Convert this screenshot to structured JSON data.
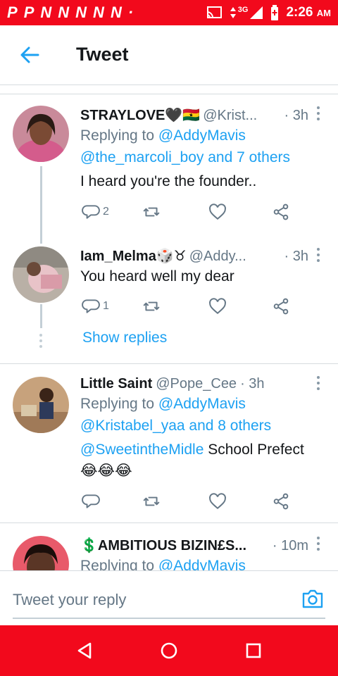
{
  "status_bar": {
    "left_icons": [
      "P",
      "P",
      "N",
      "N",
      "N",
      "N",
      "N",
      "·"
    ],
    "network": "3G",
    "time": "2:26",
    "ampm": "AM"
  },
  "header": {
    "title": "Tweet"
  },
  "tweets": [
    {
      "name": "STRAYLOVE🖤🇬🇭",
      "handle": "@Krist...",
      "time": "· 3h",
      "replying_prefix": "Replying to",
      "replying_line1": "@AddyMavis",
      "replying_line2": "@the_marcoli_boy and 7 others",
      "text": "I heard you're the founder..",
      "reply_count": "2"
    },
    {
      "name": "Iam_Melma",
      "name_emoji": "🎲♉",
      "handle": "@Addy...",
      "time": "· 3h",
      "text": "You heard well my dear",
      "reply_count": "1"
    },
    {
      "name": "Little Saint",
      "handle": "@Pope_Cee",
      "time": "· 3h",
      "replying_prefix": "Replying to",
      "replying_line1": "@AddyMavis",
      "replying_line2": "@Kristabel_yaa and 8 others",
      "mention": "@SweetintheMidle",
      "text": " School Prefect",
      "emojis": "😂😂😂"
    },
    {
      "name": "💲AMBITIOUS BIZIN£S...",
      "time": "· 10m",
      "replying_prefix": "Replying to",
      "replying_line1": "@AddyMavis"
    }
  ],
  "show_replies": "Show replies",
  "composer": {
    "placeholder": "Tweet your reply"
  },
  "colors": {
    "accent": "#1da1f2",
    "status_bar": "#f2091c",
    "secondary_text": "#657786"
  }
}
